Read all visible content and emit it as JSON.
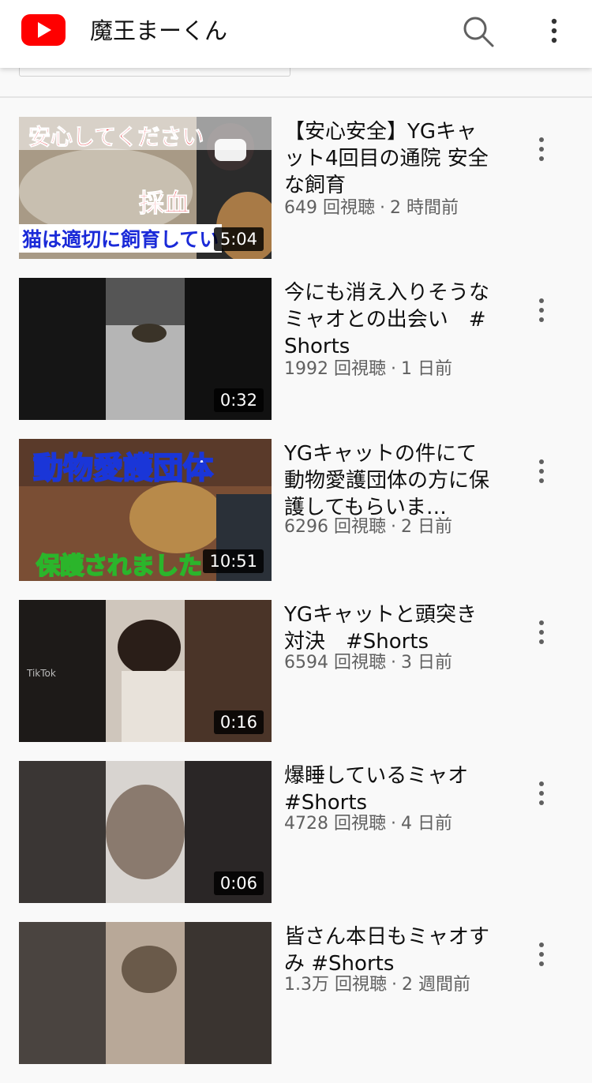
{
  "header": {
    "channel_title": "魔王まーくん",
    "logo_icon": "youtube-logo",
    "search_icon": "search-icon",
    "menu_icon": "more-vert-icon",
    "brand_color": "#ff0000"
  },
  "videos": [
    {
      "title": "【安心安全】YGキャット4回目の通院 安全な飼育",
      "views": "649 回視聴",
      "age": "2 時間前",
      "duration": "5:04",
      "thumb_text": [
        "安心してください",
        "採血",
        "猫は適切に飼育してい"
      ]
    },
    {
      "title": "今にも消え入りそうなミャオとの出会い　#Shorts",
      "views": "1992 回視聴",
      "age": "1 日前",
      "duration": "0:32"
    },
    {
      "title": "YGキャットの件にて動物愛護団体の方に保護してもらいま…",
      "views": "6296 回視聴",
      "age": "2 日前",
      "duration": "10:51",
      "thumb_text": [
        "動物愛護団体",
        "保護されました"
      ]
    },
    {
      "title": "YGキャットと頭突き対決　#Shorts",
      "views": "6594 回視聴",
      "age": "3 日前",
      "duration": "0:16",
      "thumb_text": [
        "TikTok"
      ]
    },
    {
      "title": "爆睡しているミャオ　#Shorts",
      "views": "4728 回視聴",
      "age": "4 日前",
      "duration": "0:06"
    },
    {
      "title": "皆さん本日もミャオすみ #Shorts",
      "views": "1.3万 回視聴",
      "age": "2 週間前",
      "duration": ""
    }
  ],
  "separator": "·"
}
